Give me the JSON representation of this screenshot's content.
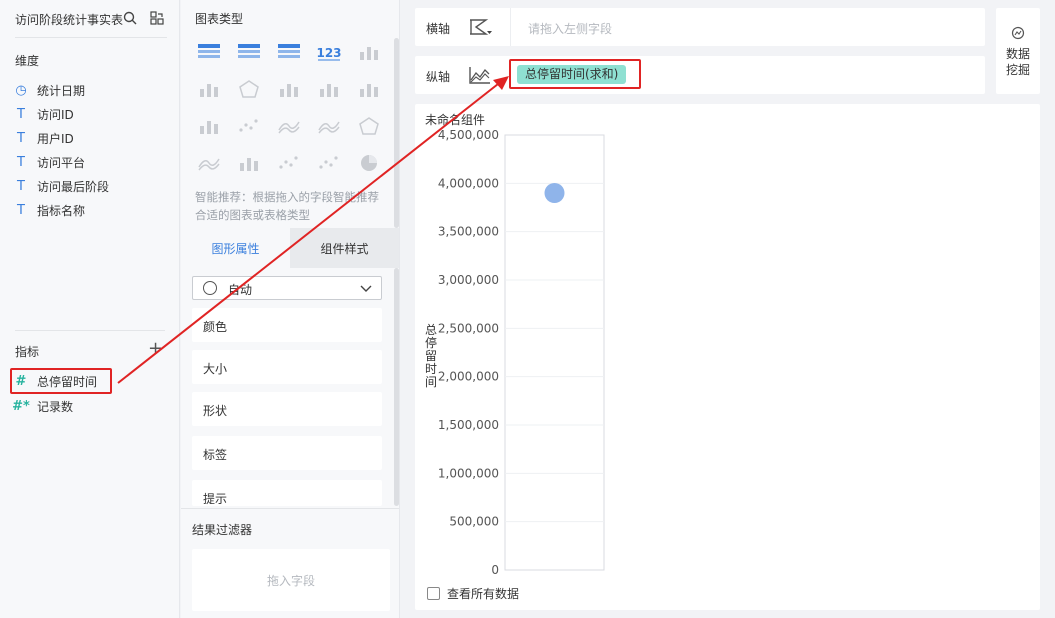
{
  "field_panel": {
    "title": "访问阶段统计事实表",
    "dimensions_label": "维度",
    "dimensions": [
      {
        "icon": "clock-icon",
        "glyph": "◷",
        "label": "统计日期"
      },
      {
        "icon": "text-type-icon",
        "glyph": "T",
        "label": "访问ID"
      },
      {
        "icon": "text-type-icon",
        "glyph": "T",
        "label": "用户ID"
      },
      {
        "icon": "text-type-icon",
        "glyph": "T",
        "label": "访问平台"
      },
      {
        "icon": "text-type-icon",
        "glyph": "T",
        "label": "访问最后阶段"
      },
      {
        "icon": "text-type-icon",
        "glyph": "T",
        "label": "指标名称"
      }
    ],
    "metrics_label": "指标",
    "add_glyph": "+",
    "metrics": [
      {
        "icon": "number-type-icon",
        "glyph": "#",
        "label": "总停留时间"
      },
      {
        "icon": "computed-number-icon",
        "glyph": "#*",
        "label": "记录数"
      }
    ]
  },
  "chart_panel": {
    "title": "图表类型",
    "hint": "智能推荐：根据拖入的字段智能推荐合适的图表或表格类型",
    "tabs": [
      "图形属性",
      "组件样式"
    ],
    "shape_select": {
      "value": "自动",
      "chevron": "⌄"
    },
    "properties": [
      "颜色",
      "大小",
      "形状",
      "标签",
      "提示"
    ],
    "filter_title": "结果过滤器",
    "filter_placeholder": "拖入字段",
    "chart_types": [
      {
        "name": "table-grouped",
        "color": "#3a7fdd"
      },
      {
        "name": "table-cross",
        "color": "#3a7fdd"
      },
      {
        "name": "table-detail",
        "color": "#3a7fdd"
      },
      {
        "name": "kpi-number",
        "color": "#3a7fdd",
        "text": "123"
      },
      {
        "name": "table-mini",
        "color": "#c9ccd1"
      },
      {
        "name": "table-compare",
        "color": "#c9ccd1"
      },
      {
        "name": "map-area",
        "color": "#c9ccd1"
      },
      {
        "name": "bar-stacked",
        "color": "#c9ccd1"
      },
      {
        "name": "bar-column",
        "color": "#c9ccd1"
      },
      {
        "name": "bar-grouped",
        "color": "#c9ccd1"
      },
      {
        "name": "heat-grid",
        "color": "#c9ccd1"
      },
      {
        "name": "scatter-step",
        "color": "#c9ccd1"
      },
      {
        "name": "line-multi",
        "color": "#c9ccd1"
      },
      {
        "name": "line-cross",
        "color": "#c9ccd1"
      },
      {
        "name": "radar",
        "color": "#c9ccd1"
      },
      {
        "name": "area-wave",
        "color": "#c9ccd1"
      },
      {
        "name": "bar-histogram",
        "color": "#c9ccd1"
      },
      {
        "name": "scatter-dots",
        "color": "#c9ccd1"
      },
      {
        "name": "funnel-dots",
        "color": "#c9ccd1"
      },
      {
        "name": "pie",
        "color": "#c9ccd1"
      }
    ]
  },
  "axes": {
    "x_label": "横轴",
    "x_placeholder": "请拖入左侧字段",
    "y_label": "纵轴",
    "y_field": "总停留时间(求和)"
  },
  "mining": {
    "label_line1": "数据",
    "label_line2": "挖掘"
  },
  "chart_card": {
    "title": "未命名组件",
    "view_all_label": "查看所有数据"
  },
  "chart_data": {
    "type": "scatter",
    "ylabel": "总停留时间",
    "yticks": [
      "0",
      "500,000",
      "1,000,000",
      "1,500,000",
      "2,000,000",
      "2,500,000",
      "3,000,000",
      "3,500,000",
      "4,000,000",
      "4,500,000"
    ],
    "ylim": [
      0,
      4500000
    ],
    "grid": true,
    "points": [
      {
        "y": 3900000
      }
    ],
    "point_color": "#8fb4ea"
  },
  "colors": {
    "accent": "#3a7fdd",
    "highlight": "#e02424",
    "pill": "#8fe0d2"
  }
}
